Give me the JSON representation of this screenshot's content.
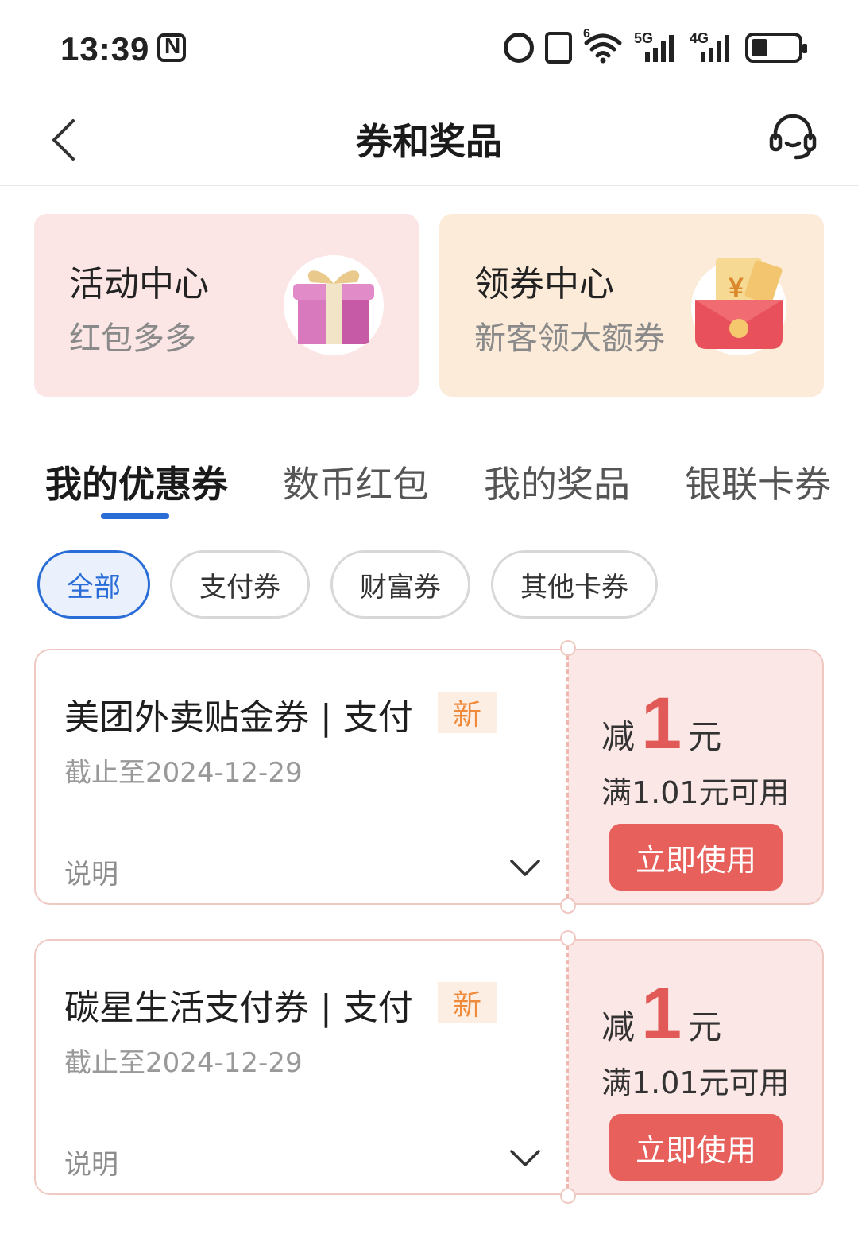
{
  "status_bar": {
    "time": "13:39",
    "signal_5g_label": "5G",
    "signal_4g_label": "4G",
    "wifi_label": "6",
    "battery_level": 0.35
  },
  "nav": {
    "title": "券和奖品"
  },
  "promos": [
    {
      "title": "活动中心",
      "subtitle": "红包多多",
      "bg": "#fbe5e5",
      "icon": "gift-icon"
    },
    {
      "title": "领券中心",
      "subtitle": "新客领大额券",
      "bg": "#fcebd9",
      "icon": "red-packet-icon"
    }
  ],
  "tabs": [
    {
      "label": "我的优惠券",
      "active": true
    },
    {
      "label": "数币红包",
      "active": false
    },
    {
      "label": "我的奖品",
      "active": false
    },
    {
      "label": "银联卡券",
      "active": false
    }
  ],
  "filters": [
    {
      "label": "全部",
      "active": true
    },
    {
      "label": "支付券",
      "active": false
    },
    {
      "label": "财富券",
      "active": false
    },
    {
      "label": "其他卡券",
      "active": false
    }
  ],
  "coupons": [
    {
      "name": "美团外卖贴金券 | 支付",
      "badge": "新",
      "expiry": "截止至2024-12-29",
      "explain": "说明",
      "discount_prefix": "减",
      "discount_amount": "1",
      "discount_unit": "元",
      "threshold": "满1.01元可用",
      "button": "立即使用"
    },
    {
      "name": "碳星生活支付券 | 支付",
      "badge": "新",
      "expiry": "截止至2024-12-29",
      "explain": "说明",
      "discount_prefix": "减",
      "discount_amount": "1",
      "discount_unit": "元",
      "threshold": "满1.01元可用",
      "button": "立即使用"
    }
  ],
  "colors": {
    "accent_blue": "#2a6dd6",
    "coupon_red": "#e7605c",
    "badge_orange": "#ef8a3a"
  }
}
